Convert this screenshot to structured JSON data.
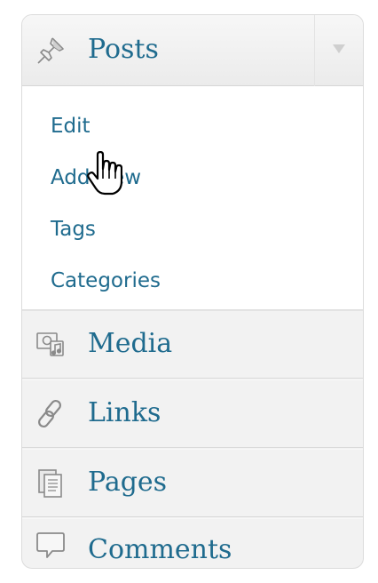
{
  "menu": {
    "posts": {
      "label": "Posts",
      "icon": "pushpin-icon",
      "toggle_icon": "triangle-down-icon",
      "submenu": {
        "edit": "Edit",
        "add_new": "Add New",
        "tags": "Tags",
        "categories": "Categories"
      }
    },
    "media": {
      "label": "Media",
      "icon": "media-icon"
    },
    "links": {
      "label": "Links",
      "icon": "chain-link-icon"
    },
    "pages": {
      "label": "Pages",
      "icon": "pages-icon"
    },
    "comments": {
      "label": "Comments",
      "icon": "speech-bubble-icon"
    }
  },
  "cursor": {
    "icon": "hand-pointer-cursor-icon"
  },
  "colors": {
    "link_text": "#1f6b8e",
    "menu_background": "#f2f2f2",
    "submenu_background": "#ffffff",
    "border": "#dcdcdc"
  }
}
